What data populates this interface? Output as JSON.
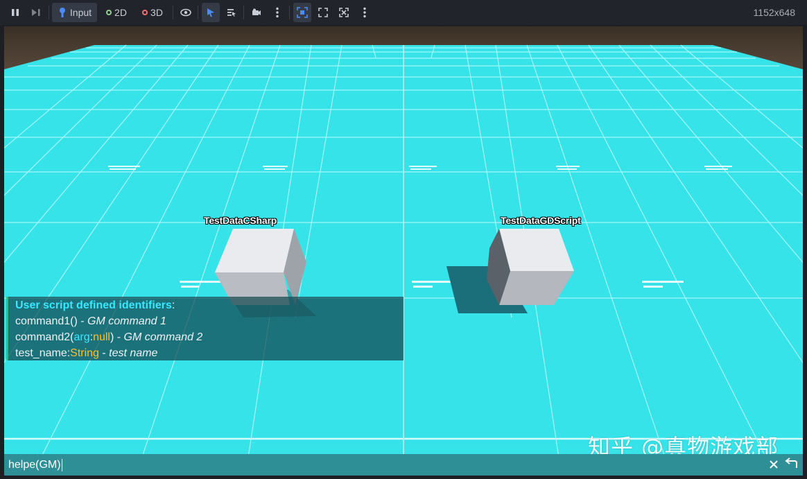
{
  "toolbar": {
    "input_label": "Input",
    "view_2d_label": "2D",
    "view_3d_label": "3D",
    "resolution": "1152x648"
  },
  "scene": {
    "cube1_label": "TestDataCSharp",
    "cube2_label": "TestDataGDScript"
  },
  "help": {
    "header": "User script defined identifiers",
    "header_colon": ":",
    "cmd1_name": "command1()",
    "cmd1_sep": " - ",
    "cmd1_desc": "GM command 1",
    "cmd2_name": "command2(",
    "cmd2_arg": "arg",
    "cmd2_colon": ":",
    "cmd2_type": "null",
    "cmd2_close": ")",
    "cmd2_sep": " - ",
    "cmd2_desc": "GM command 2",
    "var_name": "test_name:",
    "var_type": "String",
    "var_sep": " - ",
    "var_desc": "test name"
  },
  "command_bar": {
    "value": "helpe(GM)",
    "clear_icon": "close-icon",
    "enter_icon": "enter-icon"
  },
  "watermark": "知乎 @真物游戏部",
  "colors": {
    "floor": "#35e3e8",
    "help_header": "#37e8ff",
    "type_highlight": "#ffc02a",
    "panel_border": "#29c46a"
  }
}
